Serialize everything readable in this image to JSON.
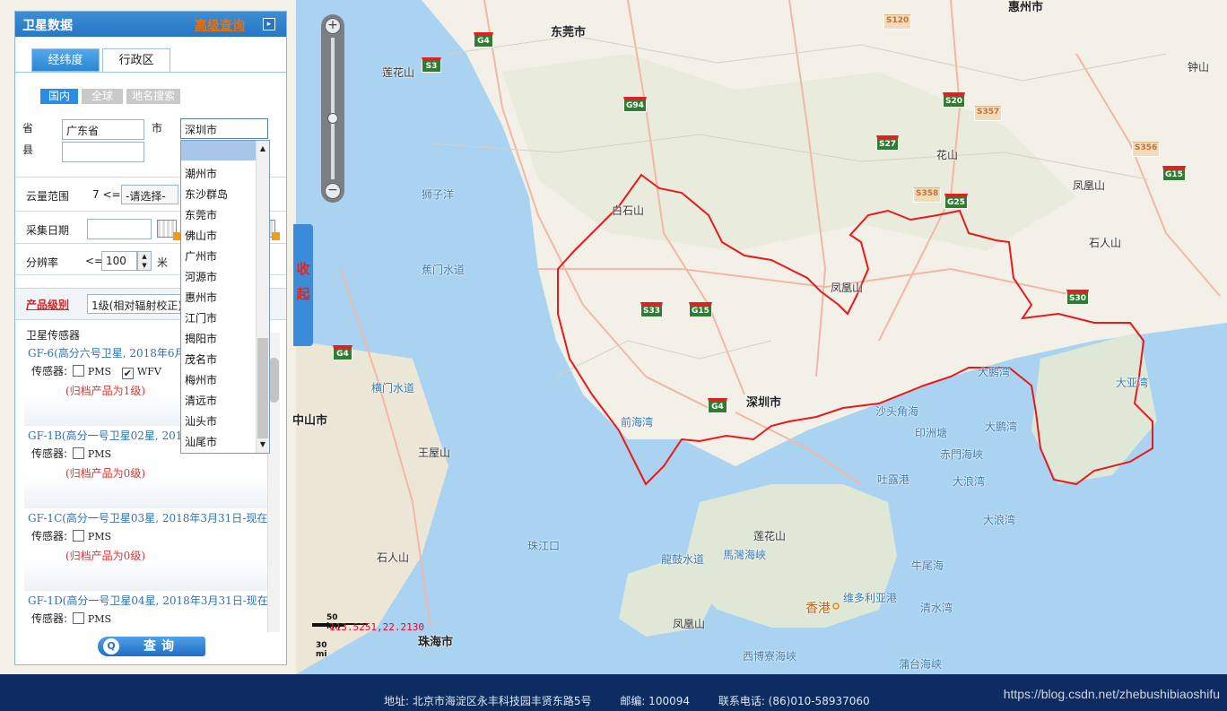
{
  "panel": {
    "title": "卫星数据",
    "header_link": "高级查询",
    "arrow_glyph": "▸",
    "tabs": [
      "经纬度",
      "行政区"
    ],
    "subtabs": [
      "国内",
      "全球",
      "地名搜索"
    ],
    "province_label": "省",
    "province_value": "广东省",
    "city_label": "市",
    "city_value": "深圳市",
    "county_label": "县",
    "cloud_label": "云量范围",
    "cloud_op": "7 <=",
    "cloud_select": "-请选择-",
    "date_label": "采集日期",
    "res_label": "分辨率",
    "res_op": "<=",
    "res_value": "100",
    "res_unit": "米",
    "level_label": "产品级别",
    "level_select": "1级(相对辐射校正)",
    "sat_header": "卫星传感器",
    "satellites": [
      {
        "title": "GF-6(高分六号卫星, 2018年6月",
        "sensors": [
          {
            "name": "PMS",
            "checked": false
          },
          {
            "name": "WFV",
            "checked": true
          }
        ],
        "note": "(归档产品为1级)"
      },
      {
        "title": "GF-1B(高分一号卫星02星, 201",
        "sensors": [
          {
            "name": "PMS",
            "checked": false
          }
        ],
        "note": "(归档产品为0级)"
      },
      {
        "title": "GF-1C(高分一号卫星03星, 2018年3月31日-现在",
        "sensors": [
          {
            "name": "PMS",
            "checked": false
          }
        ],
        "note": "(归档产品为0级)"
      },
      {
        "title": "GF-1D(高分一号卫星04星, 2018年3月31日-现在",
        "sensors": [
          {
            "name": "PMS",
            "checked": false
          }
        ],
        "note": ""
      }
    ],
    "sensor_label": "传感器:",
    "query_label": "查询",
    "query_icon": "Q"
  },
  "dropdown": {
    "options": [
      "潮州市",
      "东沙群岛",
      "东莞市",
      "佛山市",
      "广州市",
      "河源市",
      "惠州市",
      "江门市",
      "揭阳市",
      "茂名市",
      "梅州市",
      "清远市",
      "汕头市",
      "汕尾市"
    ],
    "up_glyph": "▲",
    "down_glyph": "▼"
  },
  "collapse": {
    "chars": [
      "收",
      "起"
    ]
  },
  "map": {
    "zoom_in": "+",
    "zoom_out": "−",
    "scale_km": "50 km",
    "scale_mi": "30 mi",
    "coords": "113.5251,22.2130",
    "labels": {
      "dongguan": "东莞市",
      "huizhou": "惠州市",
      "lianhuashan1": "莲花山",
      "zhongshan_hill": "钟山",
      "shiziyang": "狮子洋",
      "baishishan": "白石山",
      "huashan": "花山",
      "fenghuangshan1": "凤凰山",
      "shirenshan": "石人山",
      "jiaomenshuidao": "蕉门水道",
      "fenghuangshan2": "凤凰山",
      "hengmenshuidao": "横门水道",
      "zhongshanshi": "中山市",
      "shenzhen": "深圳市",
      "qianhaiwan": "前海湾",
      "dapengwan1": "大鹏湾",
      "dayawan": "大亚湾",
      "shatoujiaohai": "沙头角海",
      "yinzhoutang": "印洲塘",
      "dapengwan2": "大鹏湾",
      "chimenhaixia": "赤門海峽",
      "tulugang": "吐露港",
      "dalangwan1": "大浪湾",
      "dalangwan2": "大浪湾",
      "wangwushan": "王屋山",
      "zhujiangkou": "珠江口",
      "shirenshan2": "石人山",
      "lianhuashan2": "莲花山",
      "lingdingshuidao": "龍鼓水道",
      "mawanhaixia": "馬灣海峽",
      "niuweihai": "牛尾海",
      "hongkong": "香港",
      "victoria": "维多利亚港",
      "qingshuiwan": "清水湾",
      "fenghuangshan3": "凤凰山",
      "zhuhai": "珠海市",
      "xibojinghaixia": "西博寮海峽",
      "danganhaixia": "蒲台海峡"
    },
    "shields": {
      "s120": "S120",
      "g4a": "G4",
      "s3": "S3",
      "g94": "G94",
      "s20": "S20",
      "s357": "S357",
      "s27": "S27",
      "s356": "S356",
      "g15a": "G15",
      "s358": "S358",
      "g25": "G25",
      "s30": "S30",
      "s33": "S33",
      "g15b": "G15",
      "g4b": "G4",
      "g4c": "G4"
    },
    "colors": {
      "boundary": "#e8191c",
      "water": "#a9d3f0",
      "land": "#f3f0e8"
    }
  },
  "footer": {
    "address": "地址: 北京市海淀区永丰科技园丰贤东路5号",
    "postcode": "邮编: 100094",
    "phone": "联系电话: (86)010-58937060",
    "watermark": "https://blog.csdn.net/zhebushibiaoshifu"
  }
}
